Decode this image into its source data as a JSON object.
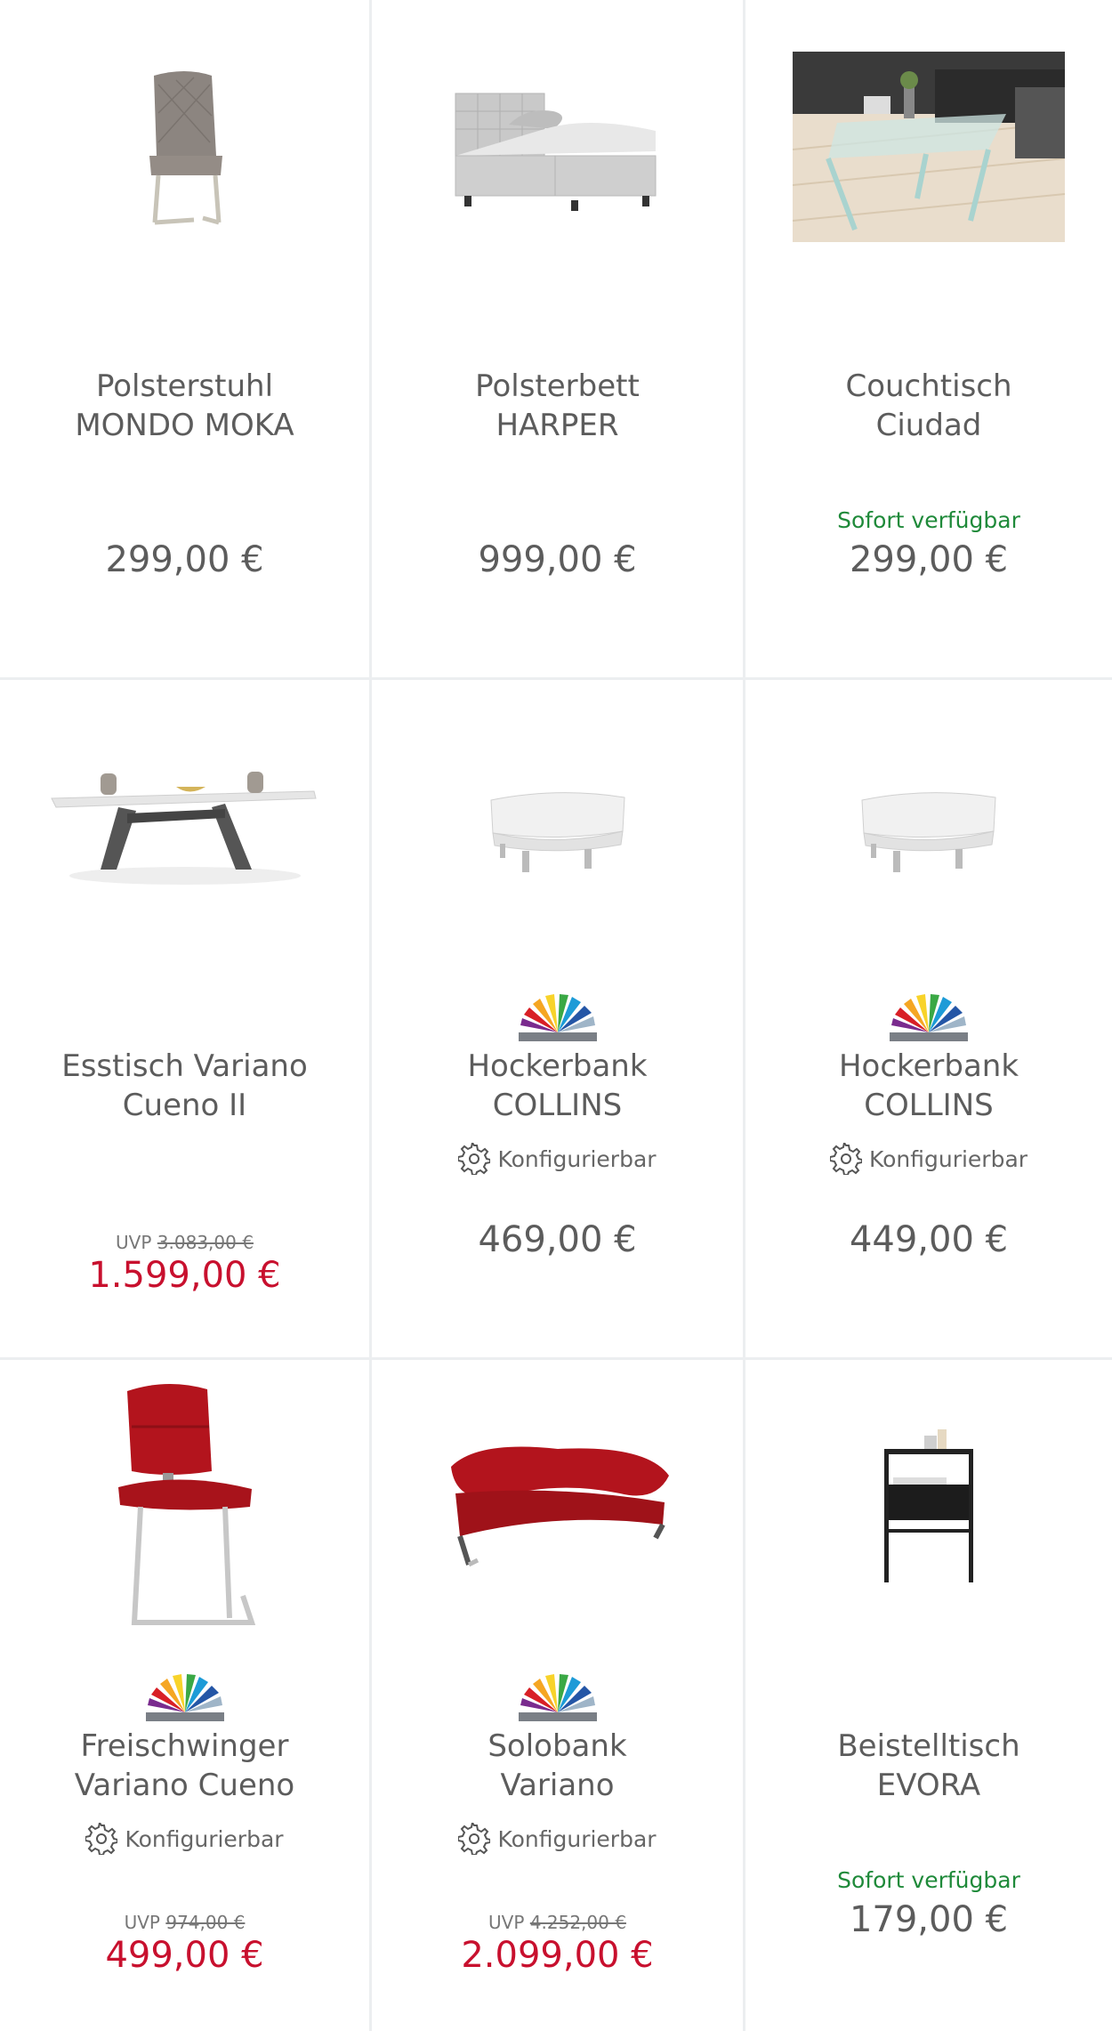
{
  "products": [
    {
      "name": "Polsterstuhl\nMONDO MOKA",
      "price": "299,00 €",
      "availability": "",
      "uvp_label": "",
      "uvp_price": "",
      "config_label": "",
      "image": "chair-gray-icon",
      "sale": false
    },
    {
      "name": "Polsterbett\nHARPER",
      "price": "999,00 €",
      "availability": "",
      "uvp_label": "",
      "uvp_price": "",
      "config_label": "",
      "image": "bed-icon",
      "sale": false
    },
    {
      "name": "Couchtisch\nCiudad",
      "price": "299,00 €",
      "availability": "Sofort verfügbar",
      "uvp_label": "",
      "uvp_price": "",
      "config_label": "",
      "image": "glass-table-photo",
      "sale": false
    },
    {
      "name": "Esstisch Variano\nCueno II",
      "price": "1.599,00 €",
      "availability": "",
      "uvp_label": "UVP",
      "uvp_price": "3.083,00 €",
      "config_label": "",
      "image": "dining-table-icon",
      "sale": true
    },
    {
      "name": "Hockerbank\nCOLLINS",
      "price": "469,00 €",
      "availability": "",
      "uvp_label": "",
      "uvp_price": "",
      "config_label": "Konfigurierbar",
      "image": "ottoman-icon",
      "sale": false
    },
    {
      "name": "Hockerbank\nCOLLINS",
      "price": "449,00 €",
      "availability": "",
      "uvp_label": "",
      "uvp_price": "",
      "config_label": "Konfigurierbar",
      "image": "ottoman-icon",
      "sale": false
    },
    {
      "name": "Freischwinger\nVariano Cueno",
      "price": "499,00 €",
      "availability": "",
      "uvp_label": "UVP",
      "uvp_price": "974,00 €",
      "config_label": "Konfigurierbar",
      "image": "chair-red-icon",
      "sale": true
    },
    {
      "name": "Solobank\nVariano",
      "price": "2.099,00 €",
      "availability": "",
      "uvp_label": "UVP",
      "uvp_price": "4.252,00 €",
      "config_label": "Konfigurierbar",
      "image": "bench-red-icon",
      "sale": true
    },
    {
      "name": "Beistelltisch\nEVORA",
      "price": "179,00 €",
      "availability": "Sofort verfügbar",
      "uvp_label": "",
      "uvp_price": "",
      "config_label": "",
      "image": "side-table-icon",
      "sale": false
    }
  ],
  "colors": {
    "sale_price": "#c8102e",
    "availability": "#1f8a3a",
    "text": "#5c5c5c",
    "divider": "#eceef0"
  }
}
